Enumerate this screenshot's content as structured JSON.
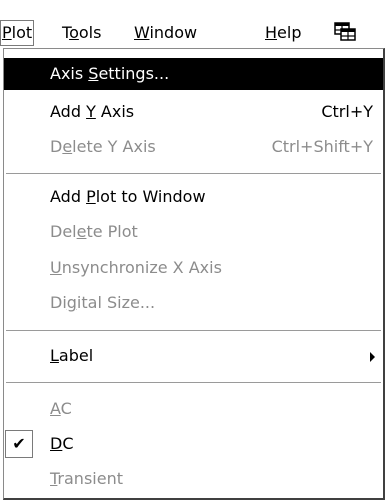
{
  "menubar": {
    "items": [
      {
        "pre": "",
        "u": "P",
        "post": "lot"
      },
      {
        "pre": "T",
        "u": "o",
        "post": "ols"
      },
      {
        "pre": "",
        "u": "W",
        "post": "indow"
      },
      {
        "pre": "",
        "u": "H",
        "post": "elp"
      }
    ],
    "active_index": 0,
    "icon": "window-grid-icon"
  },
  "menu": {
    "axis_settings": {
      "pre": "Axis ",
      "u": "S",
      "post": "ettings..."
    },
    "add_y_axis": {
      "pre": "Add ",
      "u": "Y",
      "post": " Axis",
      "shortcut": "Ctrl+Y"
    },
    "delete_y_axis": {
      "pre": "D",
      "u": "e",
      "post": "lete Y Axis",
      "shortcut": "Ctrl+Shift+Y"
    },
    "add_plot": {
      "pre": "Add ",
      "u": "P",
      "post": "lot to Window"
    },
    "delete_plot": {
      "pre": "Del",
      "u": "e",
      "post": "te Plot"
    },
    "unsync_x": {
      "pre": "",
      "u": "U",
      "post": "nsynchronize X Axis"
    },
    "digital_size": {
      "pre": "Di",
      "u": "g",
      "post": "ital Size..."
    },
    "label": {
      "pre": "",
      "u": "L",
      "post": "abel"
    },
    "ac": {
      "pre": "",
      "u": "A",
      "post": "C"
    },
    "dc": {
      "pre": "",
      "u": "D",
      "post": "C"
    },
    "transient": {
      "pre": "",
      "u": "T",
      "post": "ransient"
    },
    "check_glyph": "✔"
  }
}
